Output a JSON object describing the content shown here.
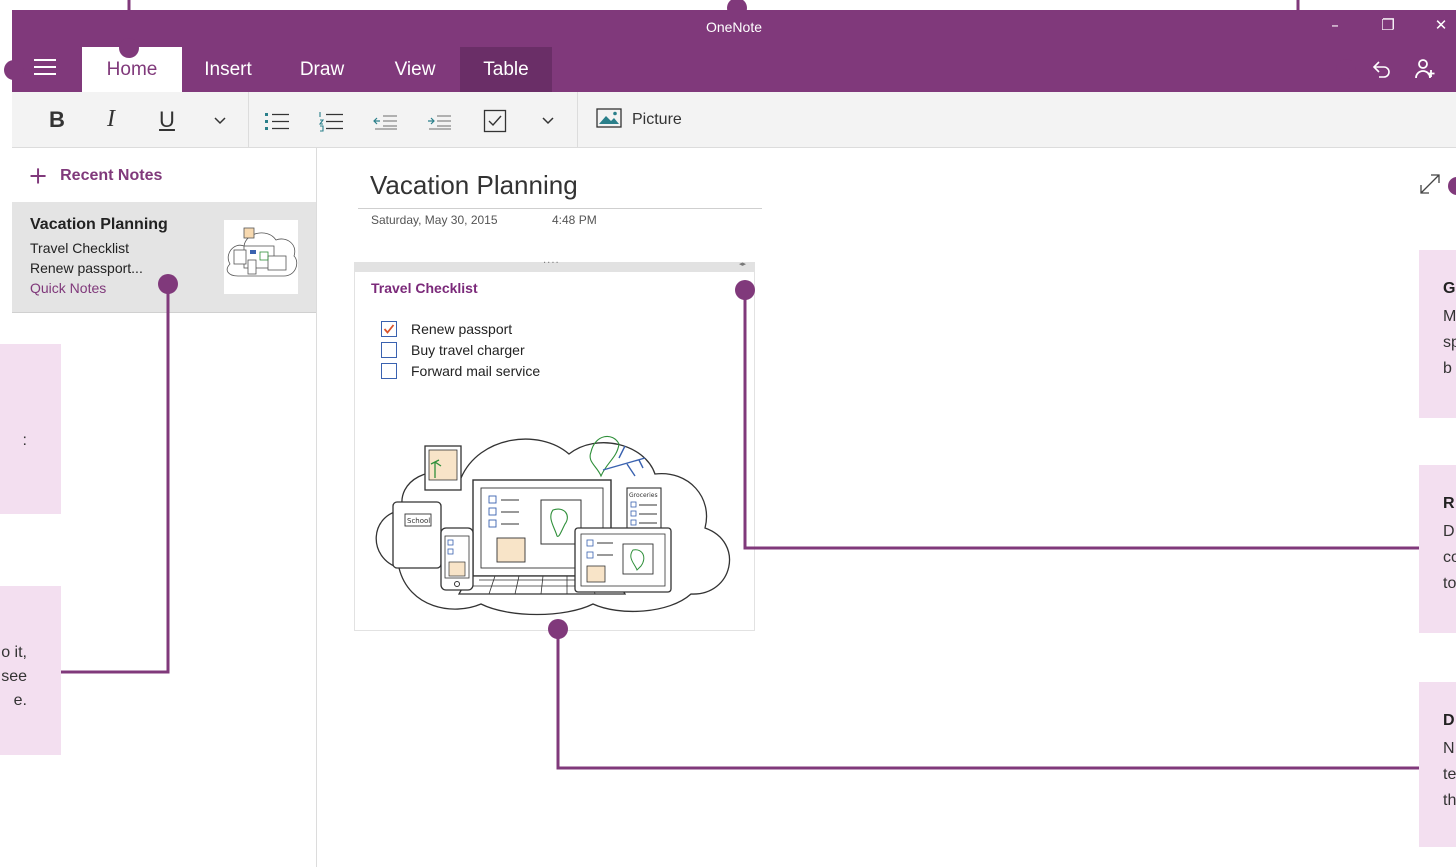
{
  "app": {
    "title": "OneNote"
  },
  "window_controls": {
    "minimize": "–",
    "restore": "❐",
    "close": "✕"
  },
  "tabs": [
    {
      "label": "Home",
      "active": true
    },
    {
      "label": "Insert"
    },
    {
      "label": "Draw"
    },
    {
      "label": "View"
    },
    {
      "label": "Table",
      "contextual": true
    }
  ],
  "titlebar_icons": {
    "undo": "undo-icon",
    "share": "share-person-icon",
    "menu": "hamburger-menu-icon"
  },
  "ribbon": {
    "bold": "B",
    "italic": "I",
    "underline": "U",
    "picture_label": "Picture"
  },
  "sidebar": {
    "recent_plus": "+",
    "recent_label": "Recent Notes",
    "note": {
      "title": "Vacation Planning",
      "line1": "Travel Checklist",
      "line2": "Renew passport...",
      "section": "Quick Notes"
    }
  },
  "page": {
    "title": "Vacation Planning",
    "date": "Saturday, May 30, 2015",
    "time": "4:48 PM",
    "container_title": "Travel Checklist",
    "checklist": [
      {
        "label": "Renew passport",
        "checked": true
      },
      {
        "label": "Buy travel charger",
        "checked": false
      },
      {
        "label": "Forward mail service",
        "checked": false
      }
    ]
  },
  "callouts": {
    "left_middle": {
      "lines": [
        "o it,",
        "see",
        "e."
      ]
    },
    "right_1": {
      "title": "G",
      "lines": [
        "M",
        "sp",
        "b"
      ]
    },
    "right_2": {
      "title": "R",
      "lines": [
        "D",
        "co",
        "to"
      ]
    },
    "right_3": {
      "title": "D",
      "lines": [
        "N",
        "te",
        "th"
      ]
    }
  },
  "colors": {
    "brand": "#80397b",
    "callout_bg": "#f3dff0",
    "leader_line": "#80397b",
    "checkbox": "#3a62b0",
    "check_mark": "#d9532c"
  }
}
